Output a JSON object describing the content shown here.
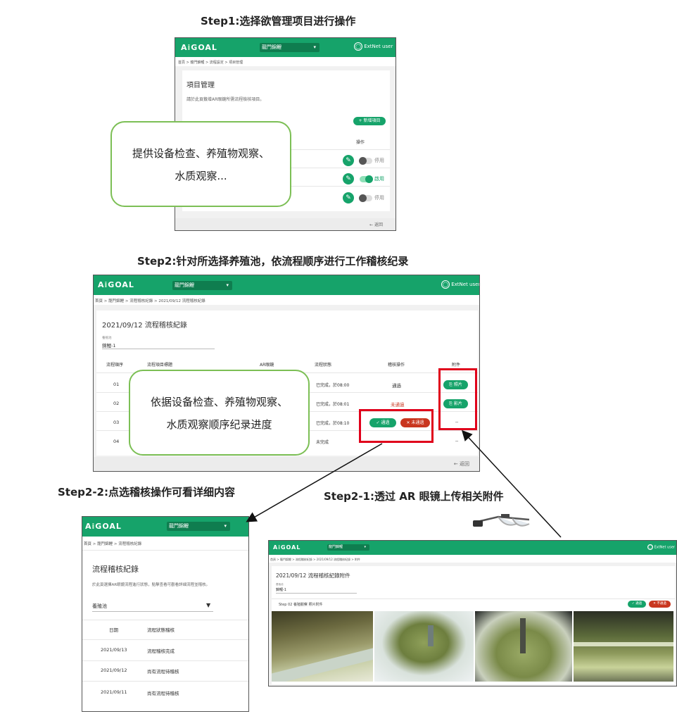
{
  "steps": {
    "step1": "Step1:选择欲管理项目进行操作",
    "step2": "Step2:针对所选择养殖池，依流程顺序进行工作稽核纪录",
    "step2_2": "Step2-2:点选稽核操作可看详细内容",
    "step2_1": "Step2-1:透过 AR 眼镜上传相关附件"
  },
  "common": {
    "logo_a": "A",
    "logo_i": "i",
    "logo_rest": "GOAL",
    "pond": "龍門錦鯉",
    "user": "ExtNet user",
    "back": "← 返回"
  },
  "screen1": {
    "breadcrumb": "首頁 > 龍門錦鯉 > 流程設定 > 項目管理",
    "title": "項目管理",
    "desc": "請於此頁籤增AR眼鏡所需流程檢核項目。",
    "add_btn": "+ 新增項目",
    "col_action": "操作",
    "rows": [
      {
        "status": "停用"
      },
      {
        "status": "啟用"
      },
      {
        "status": "停用"
      }
    ],
    "callout": [
      "提供设备检查、养殖物观察、",
      "水质观察..."
    ]
  },
  "screen2": {
    "breadcrumb": "首頁 > 龍門錦鯉 > 流程稽核紀錄 > 2021/09/12 流程稽核紀錄",
    "title": "2021/09/12 流程稽核紀錄",
    "field_label": "養殖池",
    "field_value": "錦鯉-1",
    "headers": {
      "order": "流程順序",
      "title": "流程項目標題",
      "ar": "AR眼鏡",
      "status": "流程狀態",
      "audit": "稽核操作",
      "attach": "附件"
    },
    "rows": [
      {
        "order": "01",
        "status": "已完成，於08:00",
        "audit": "通過",
        "attach": "照片"
      },
      {
        "order": "02",
        "status": "已完成，於08:01",
        "audit": "未通過",
        "attach": "影片"
      },
      {
        "order": "03",
        "status": "已完成，於08:10",
        "audit": "",
        "attach": "--"
      },
      {
        "order": "04",
        "status": "未完成",
        "audit": "",
        "attach": "--"
      }
    ],
    "pass_btn": "✓ 通過",
    "fail_btn": "✕ 未通過",
    "callout": [
      "依据设备检查、养殖物观察、",
      "水质观察顺序纪录进度"
    ]
  },
  "screen3": {
    "breadcrumb": "首頁 > 龍門錦鯉 > 流程稽核紀錄",
    "title": "流程稽核紀錄",
    "desc": "於此頁選擇AR眼鏡流程進行狀態，點擊查看可觀看詳細流程並稽核。",
    "select": "養殖池",
    "headers": {
      "date": "日期",
      "status": "流程狀態稽核"
    },
    "rows": [
      {
        "date": "2021/09/13",
        "status": "流程稽核完成"
      },
      {
        "date": "2021/09/12",
        "status": "尚有流程待稽核"
      },
      {
        "date": "2021/09/11",
        "status": "尚有流程待稽核"
      }
    ]
  },
  "screen4": {
    "breadcrumb": "首頁 > 龍門錦鯉 > 流程稽核紀錄 > 2021/09/12 流程稽核紀錄 > 附件",
    "title": "2021/09/12 流程稽核紀錄附件",
    "field_label": "養殖池",
    "field_value": "錦鯉-1",
    "step_label": "Step 02 養殖觀察 照片附件",
    "pass_btn": "✓ 通過",
    "fail_btn": "✕ 不通過"
  },
  "colors": {
    "brand": "#16a36a",
    "callout_border": "#7cbf55",
    "highlight": "#e0001b",
    "fail": "#c9361f"
  }
}
